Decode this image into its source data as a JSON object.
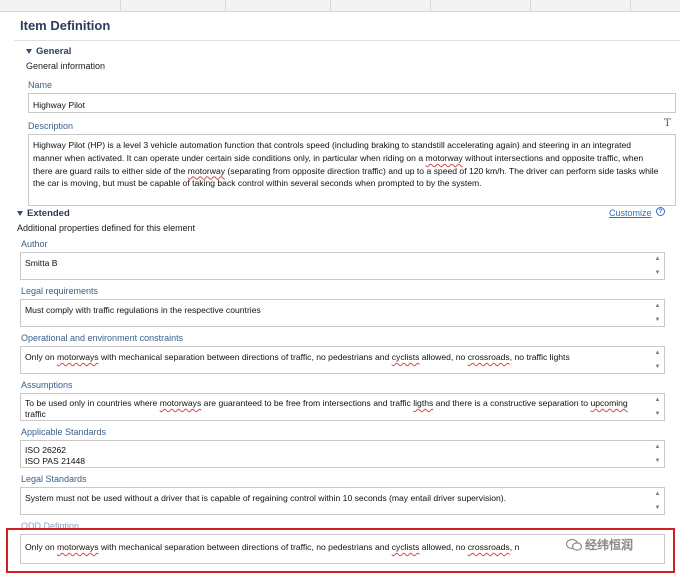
{
  "title": "Item Definition",
  "general": {
    "header": "General",
    "subtitle": "General information",
    "name_label": "Name",
    "name_value": "Highway Pilot",
    "description_label": "Description",
    "description_parts": [
      "Highway Pilot (HP) is a level 3 vehicle automation function that controls speed (including braking to standstill accelerating again)  and steering in an integrated manner when activated. It can operate under certain side conditions only, in particular when riding on a ",
      "motorway",
      " without intersections and opposite traffic, when there are guard rails to either side of the ",
      "motorway",
      " (separating from opposite direction traffic) and up to a speed of 120 km/h. The driver can perform side tasks while the car is moving, but must be capable of taking back control within several seconds when prompted to by the system."
    ]
  },
  "extended": {
    "header": "Extended",
    "subtitle": "Additional properties defined for this element",
    "customize_label": "Customize",
    "author_label": "Author",
    "author_value": "Smitta B",
    "legal_req_label": "Legal requirements",
    "legal_req_value": "Must comply with traffic regulations in the respective countries",
    "operational_label": "Operational and environment constraints",
    "operational_parts": [
      "Only on ",
      "motorways",
      " with mechanical separation between directions of traffic, no pedestrians and ",
      "cyclists",
      " allowed, no ",
      "crossroads",
      ", no traffic lights"
    ],
    "assumptions_label": "Assumptions",
    "assumptions_parts": [
      "To be used only in countries where ",
      "motorways",
      " are guaranteed to be free from intersections and traffic ",
      "ligths",
      " and there is a constructive separation to ",
      "upcoming",
      " traffic"
    ],
    "standards_label": "Applicable Standards",
    "standards_lines": [
      "ISO 26262",
      "ISO PAS 21448"
    ],
    "legal_std_label": "Legal Standards",
    "legal_std_value": "System must not be used without a driver that is capable of regaining control within 10 seconds (may entail driver supervision).",
    "odd_label": "ODD Defintion",
    "odd_parts": [
      "Only on ",
      "motorways",
      " with mechanical separation between directions of traffic, no pedestrians and ",
      "cyclists",
      " allowed, no ",
      "crossroads",
      ", n"
    ]
  },
  "watermark": "经纬恒润",
  "colors": {
    "title": "#2b3d5a",
    "label": "#3b5f8a",
    "link": "#2d6ebd",
    "highlight": "#d12020",
    "spell_error": "#d04a4a"
  }
}
